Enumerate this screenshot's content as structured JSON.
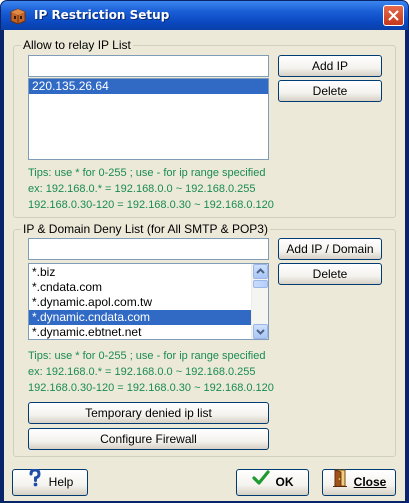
{
  "window": {
    "title": "IP Restriction Setup"
  },
  "relay_group": {
    "label": "Allow to relay IP List",
    "input_value": "",
    "add_button": "Add IP",
    "delete_button": "Delete",
    "items": [
      "220.135.26.64"
    ],
    "tips": [
      "Tips: use * for 0-255 ; use - for ip range specified",
      "ex: 192.168.0.* = 192.168.0.0 ~ 192.168.0.255",
      "192.168.0.30-120 = 192.168.0.30 ~ 192.168.0.120"
    ]
  },
  "deny_group": {
    "label": "IP & Domain Deny List (for All SMTP & POP3)",
    "input_value": "",
    "add_button": "Add IP / Domain",
    "delete_button": "Delete",
    "items": [
      "*.biz",
      "*.cndata.com",
      "*.dynamic.apol.com.tw",
      "*.dynamic.cndata.com",
      "*.dynamic.ebtnet.net"
    ],
    "tips": [
      "Tips: use * for 0-255 ; use - for ip range specified",
      "ex: 192.168.0.* = 192.168.0.0 ~ 192.168.0.255",
      "192.168.0.30-120 = 192.168.0.30 ~ 192.168.0.120"
    ],
    "temp_denied_button": "Temporary denied ip list",
    "configure_firewall_button": "Configure Firewall"
  },
  "footer": {
    "help_button": "Help",
    "ok_button": "OK",
    "close_button": "Close"
  },
  "colors": {
    "title_bar": "#0b4ac2",
    "selection": "#316ac5",
    "tips_text": "#1a8c50",
    "dialog_bg": "#ece9d8"
  },
  "icons": {
    "title": "firewall-box-icon",
    "help": "question-mark-icon",
    "ok": "check-mark-icon",
    "close": "door-exit-icon"
  }
}
